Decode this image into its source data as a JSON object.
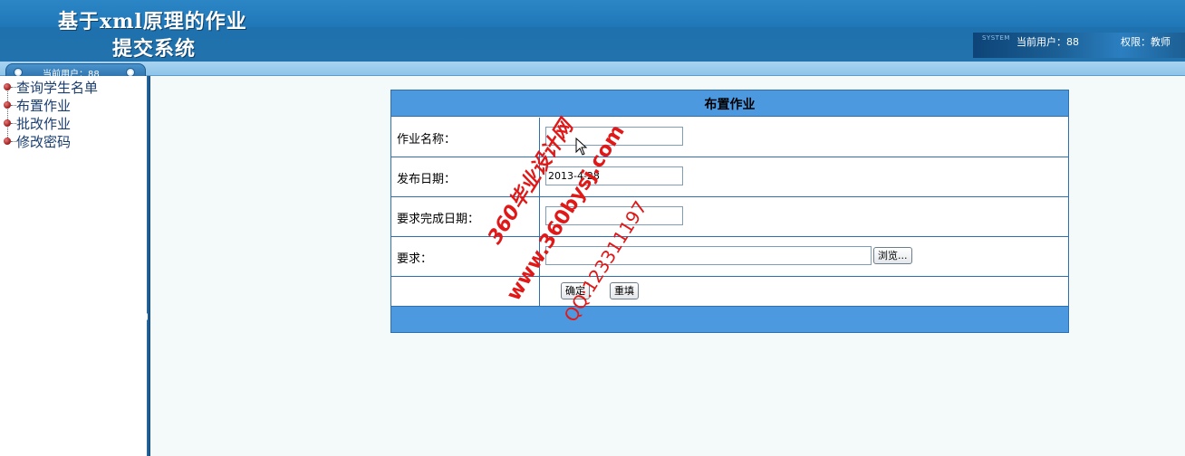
{
  "header": {
    "title_line1": "基于xml原理的作业",
    "title_line2": "提交系统",
    "system_tag": "SYSTEM",
    "current_user": "当前用户：88",
    "role": "权限：教师"
  },
  "tab": {
    "label": "当前用户：88"
  },
  "sidebar": {
    "items": [
      {
        "label": "查询学生名单"
      },
      {
        "label": "布置作业"
      },
      {
        "label": "批改作业"
      },
      {
        "label": "修改密码"
      }
    ]
  },
  "form": {
    "title": "布置作业",
    "fields": [
      {
        "label": "作业名称：",
        "value": ""
      },
      {
        "label": "发布日期：",
        "value": "2013-4-28"
      },
      {
        "label": "要求完成日期：",
        "value": ""
      },
      {
        "label": "要求：",
        "value": ""
      }
    ],
    "browse_label": "浏览...",
    "submit_label": "确定",
    "reset_label": "重填"
  },
  "watermark": {
    "line1": "360毕业设计网",
    "line2": "www.360bysj.com",
    "line3": "QQ:123311197"
  },
  "colors": {
    "header_blue": "#1f77b8",
    "form_header": "#4d99e0",
    "form_border": "#2d6fb0",
    "watermark_red": "#e01818"
  }
}
